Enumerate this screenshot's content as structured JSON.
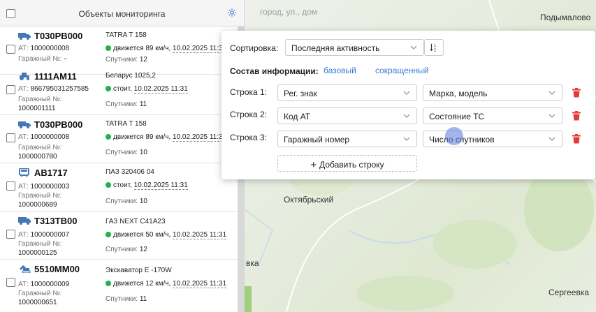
{
  "sidebar": {
    "title": "Объекты мониторинга",
    "rows": [
      {
        "plate": "Т030РВ000",
        "icon": "truck-icon",
        "at_label": "АТ:",
        "at": "1000000008",
        "garage_label": "Гаражный №:",
        "garage": "-",
        "model": "TATRA T 158",
        "status": "движется 89 км/ч,",
        "time": "10.02.2025 11:31",
        "sat_label": "Спутники:",
        "sats": "12"
      },
      {
        "plate": "1111АМ11",
        "icon": "tractor-icon",
        "at_label": "АТ:",
        "at": "866795031257585",
        "garage_label": "Гаражный №:",
        "garage": "1000001111",
        "model": "Беларус 1025,2",
        "status": "стоит,",
        "time": "10.02.2025 11:31",
        "sat_label": "Спутники:",
        "sats": "11"
      },
      {
        "plate": "Т030РВ000",
        "icon": "truck-icon",
        "at_label": "АТ:",
        "at": "1000000008",
        "garage_label": "Гаражный №:",
        "garage": "1000000780",
        "model": "TATRA T 158",
        "status": "движется 89 км/ч,",
        "time": "10.02.2025 11:31",
        "sat_label": "Спутники:",
        "sats": "10"
      },
      {
        "plate": "АВ1717",
        "icon": "bus-icon",
        "at_label": "АТ:",
        "at": "1000000003",
        "garage_label": "Гаражный №:",
        "garage": "1000000689",
        "model": "ПАЗ 320406 04",
        "status": "стоит,",
        "time": "10.02.2025 11:31",
        "sat_label": "Спутники:",
        "sats": "10"
      },
      {
        "plate": "Т313ТВ00",
        "icon": "van-icon",
        "at_label": "АТ:",
        "at": "1000000007",
        "garage_label": "Гаражный №:",
        "garage": "1000000125",
        "model": "ГАЗ NEXT C41A23",
        "status": "движется 50 км/ч,",
        "time": "10.02.2025 11:31",
        "sat_label": "Спутники:",
        "sats": "12"
      },
      {
        "plate": "5510ММ00",
        "icon": "excavator-icon",
        "at_label": "АТ:",
        "at": "1000000009",
        "garage_label": "Гаражный №:",
        "garage": "1000000651",
        "model": "Экскаватор E -170W",
        "status": "движется 12 км/ч,",
        "time": "10.02.2025 11:31",
        "sat_label": "Спутники:",
        "sats": "11"
      }
    ]
  },
  "map": {
    "search_placeholder": "город, ул., дом",
    "labels": [
      "Подымалово",
      "Октябрьский",
      "вка",
      "Сергеевка"
    ]
  },
  "popup": {
    "sort_label": "Сортировка:",
    "sort_value": "Последняя активность",
    "composition_label": "Состав информации:",
    "link_basic": "базовый",
    "link_short": "сокращенный",
    "lines": [
      {
        "label": "Строка 1:",
        "left": "Рег. знак",
        "right": "Марка, модель"
      },
      {
        "label": "Строка 2:",
        "left": "Код АТ",
        "right": "Состояние ТС"
      },
      {
        "label": "Строка 3:",
        "left": "Гаражный номер",
        "right": "Число спутников"
      }
    ],
    "add_row": "Добавить строку"
  },
  "colors": {
    "accent": "#3a7bd5",
    "status_green": "#22b14c",
    "delete_red": "#e53935"
  }
}
